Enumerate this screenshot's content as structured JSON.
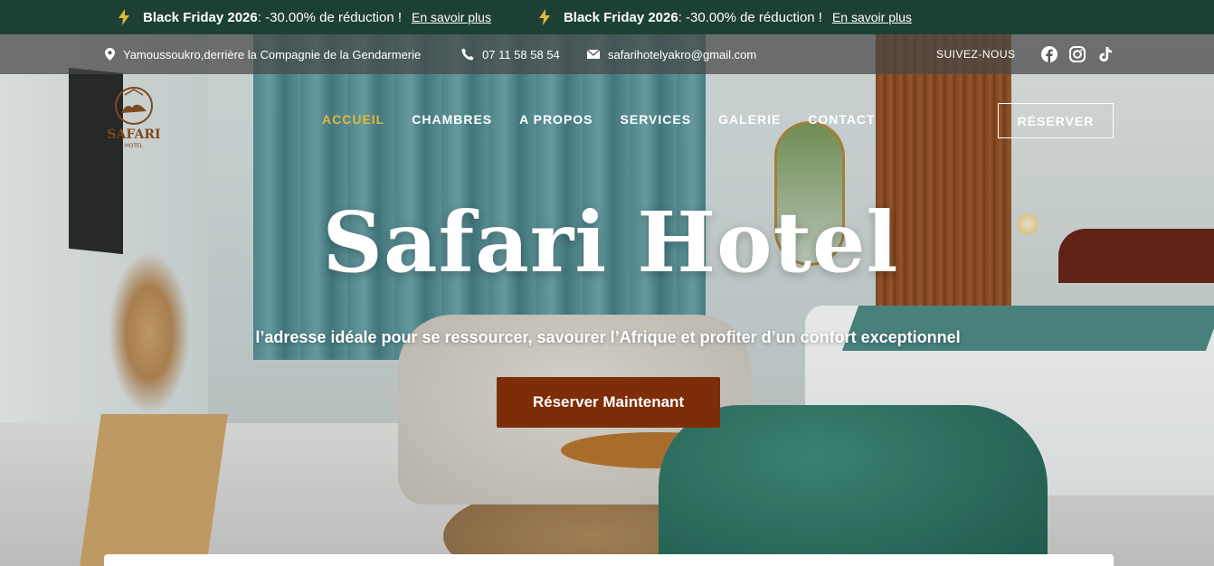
{
  "promo": {
    "items": [
      {
        "title": "Black Friday 2026",
        "text": " : -30.00% de réduction ! ",
        "link": "En savoir plus"
      },
      {
        "title": "Black Friday 2026",
        "text": " : -30.00% de réduction ! ",
        "link": "En savoir plus"
      }
    ],
    "background": "#1d4034",
    "bolt_color": "#e3b83a"
  },
  "contact": {
    "address": "Yamoussoukro,derrière la Compagnie de la Gendarmerie",
    "phone": "07 11 58 58 54",
    "email": "safarihotelyakro@gmail.com",
    "follow_label": "SUIVEZ-NOUS",
    "social_icons": [
      "facebook-icon",
      "instagram-icon",
      "tiktok-icon"
    ]
  },
  "logo": {
    "name": "SAFARI",
    "subtitle": "HOTEL"
  },
  "nav": {
    "items": [
      "ACCUEIL",
      "CHAMBRES",
      "A PROPOS",
      "SERVICES",
      "GALERIE",
      "CONTACT"
    ],
    "active_index": 0,
    "active_color": "#e3b83a",
    "reserve_label": "RÉSERVER"
  },
  "hero": {
    "title": "Safari Hotel",
    "subtitle": "l’adresse idéale pour se ressourcer, savourer l’Afrique et profiter d’un confort exceptionnel",
    "cta_label": "Réserver Maintenant",
    "cta_color": "#7e2d09"
  }
}
